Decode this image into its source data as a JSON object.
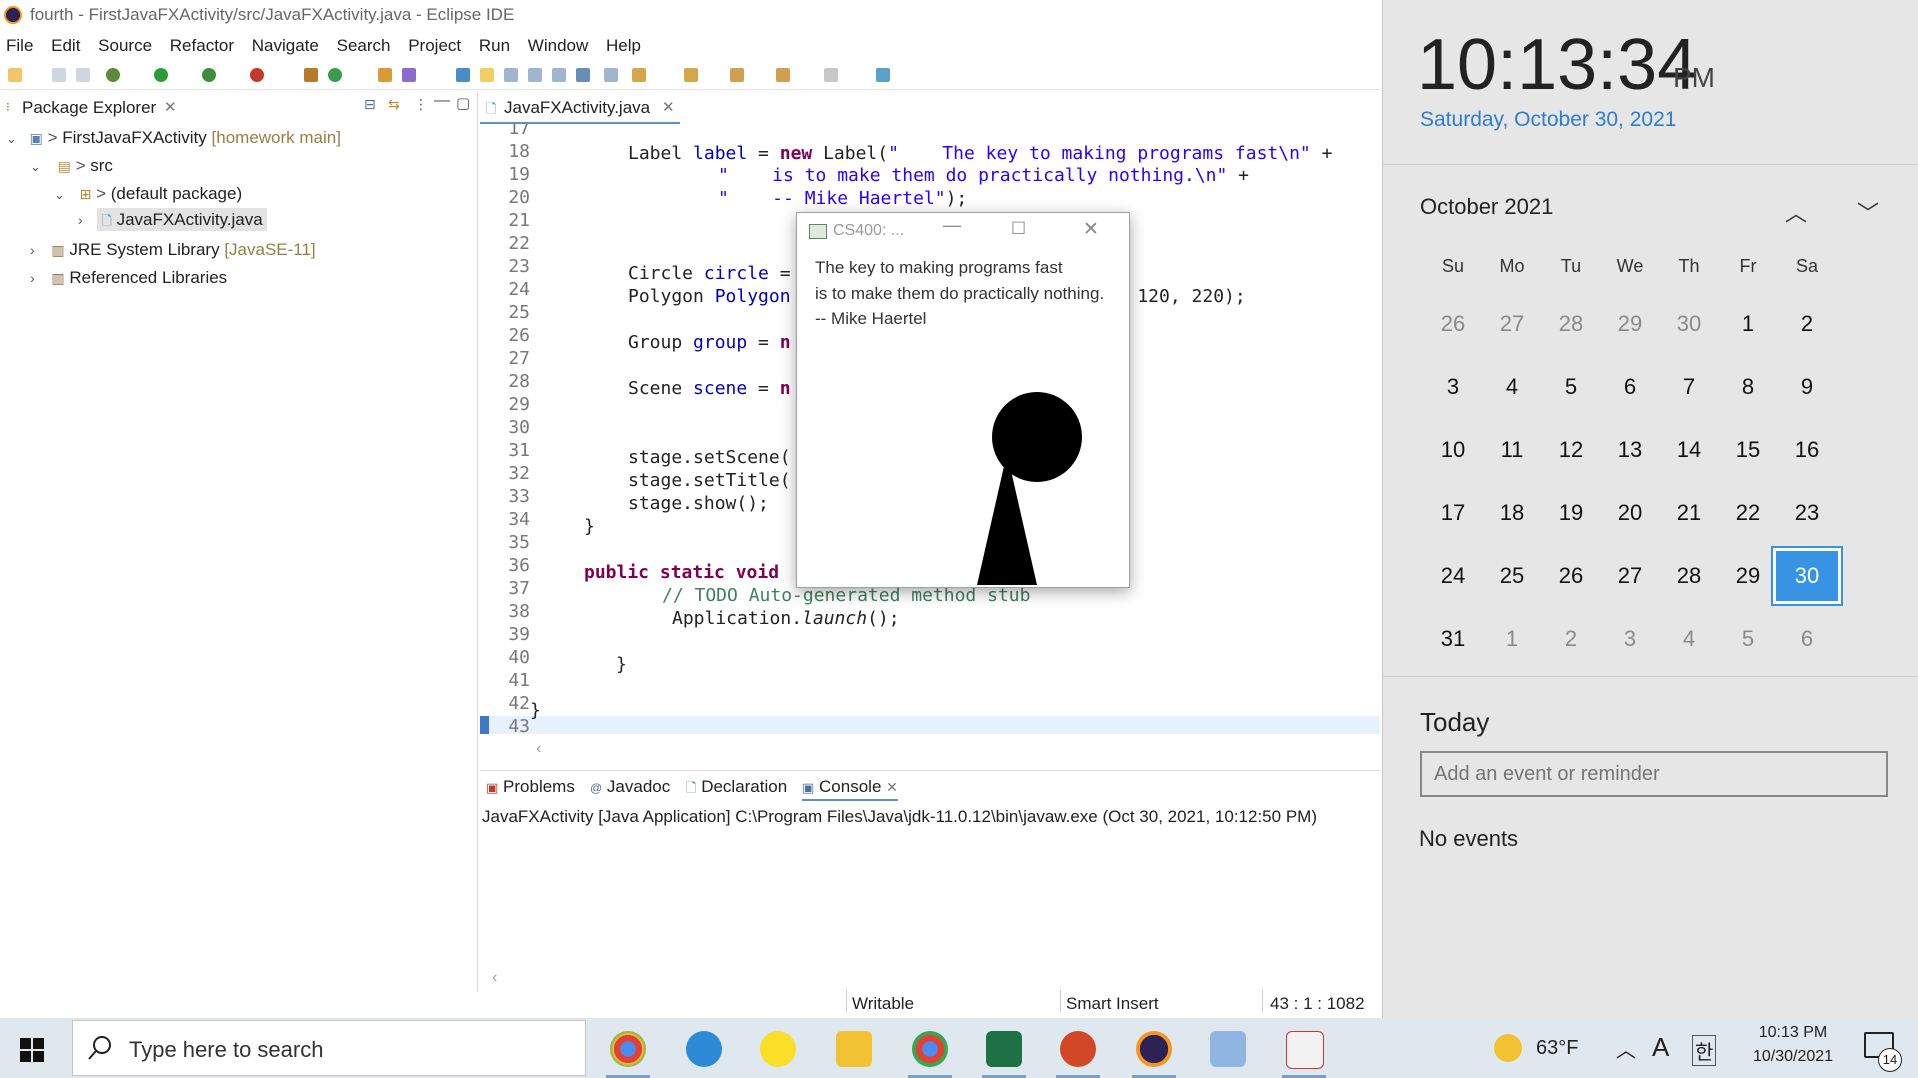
{
  "window": {
    "title": "fourth - FirstJavaFXActivity/src/JavaFXActivity.java - Eclipse IDE"
  },
  "menu": [
    "File",
    "Edit",
    "Source",
    "Refactor",
    "Navigate",
    "Search",
    "Project",
    "Run",
    "Window",
    "Help"
  ],
  "package_explorer": {
    "tab_label": "Package Explorer",
    "project": "FirstJavaFXActivity",
    "project_branch": "[homework main]",
    "src": "src",
    "default_package": "(default package)",
    "file": "JavaFXActivity.java",
    "jre": "JRE System Library",
    "jre_version": "[JavaSE-11]",
    "referenced": "Referenced Libraries"
  },
  "editor": {
    "tab_label": "JavaFXActivity.java",
    "line_numbers": [
      "17",
      "18",
      "19",
      "20",
      "21",
      "22",
      "23",
      "24",
      "25",
      "26",
      "27",
      "28",
      "29",
      "30",
      "31",
      "32",
      "33",
      "34",
      "35",
      "36",
      "37",
      "38",
      "39",
      "40",
      "41",
      "42",
      "43"
    ]
  },
  "fx_window": {
    "title": "CS400: ...",
    "line1": "The key to making programs fast",
    "line2": "is to make them do practically nothing.",
    "line3": "-- Mike Haertel"
  },
  "bottom_panel": {
    "tabs": [
      "Problems",
      "Javadoc",
      "Declaration",
      "Console"
    ],
    "console_header": "JavaFXActivity [Java Application] C:\\Program Files\\Java\\jdk-11.0.12\\bin\\javaw.exe  (Oct 30, 2021, 10:12:50 PM)"
  },
  "status": {
    "writable": "Writable",
    "insert": "Smart Insert",
    "position": "43 : 1 : 1082"
  },
  "calendar": {
    "time": "10:13:34",
    "ampm": "PM",
    "date": "Saturday, October 30, 2021",
    "month": "October 2021",
    "dow": [
      "Su",
      "Mo",
      "Tu",
      "We",
      "Th",
      "Fr",
      "Sa"
    ],
    "weeks": [
      [
        "26",
        "27",
        "28",
        "29",
        "30",
        "1",
        "2"
      ],
      [
        "3",
        "4",
        "5",
        "6",
        "7",
        "8",
        "9"
      ],
      [
        "10",
        "11",
        "12",
        "13",
        "14",
        "15",
        "16"
      ],
      [
        "17",
        "18",
        "19",
        "20",
        "21",
        "22",
        "23"
      ],
      [
        "24",
        "25",
        "26",
        "27",
        "28",
        "29",
        "30"
      ],
      [
        "31",
        "1",
        "2",
        "3",
        "4",
        "5",
        "6"
      ]
    ],
    "today_heading": "Today",
    "event_placeholder": "Add an event or reminder",
    "no_events": "No events"
  },
  "taskbar": {
    "search_placeholder": "Type here to search",
    "weather": "63°F",
    "ime_a": "A",
    "ime_han": "한",
    "clock_time": "10:13 PM",
    "clock_date": "10/30/2021",
    "notifications": "14",
    "apps": [
      "chrome-y-icon",
      "edge-icon",
      "kakaotalk-icon",
      "file-explorer-icon",
      "chrome-icon",
      "excel-icon",
      "powerpoint-icon",
      "eclipse-icon",
      "paint-icon",
      "java-icon"
    ]
  },
  "colors": {
    "accent": "#3794e5",
    "keyword": "#7f0055",
    "string": "#2a00ff",
    "comment": "#3f7f5f"
  }
}
